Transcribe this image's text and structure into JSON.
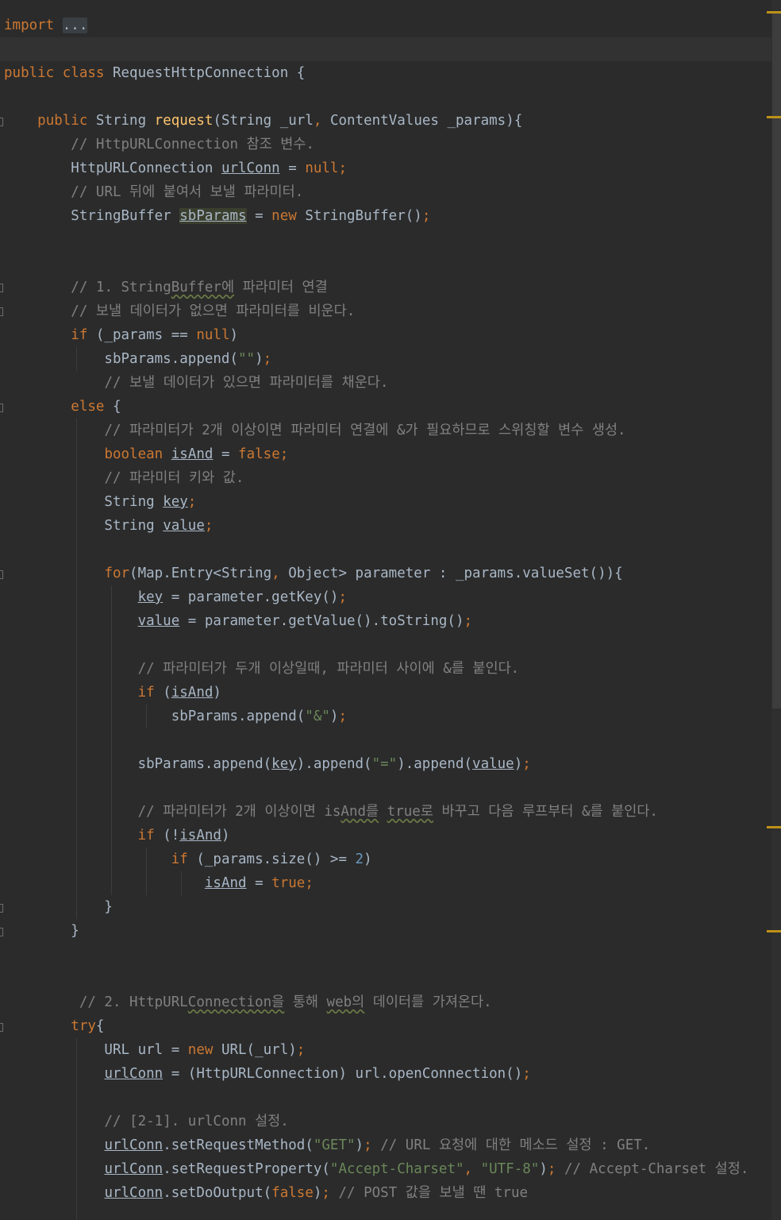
{
  "editor": {
    "language": "java",
    "theme_colors": {
      "background": "#2b2b2b",
      "keyword": "#cc7832",
      "comment": "#808080",
      "string": "#6a8759",
      "number": "#6897bb",
      "method_declaration": "#ffc66d",
      "default_text": "#a9b7c6",
      "warning_stripe": "#be9117"
    },
    "lines": [
      [
        [
          "k",
          "import"
        ],
        [
          "d",
          " "
        ],
        [
          "fold",
          "..."
        ]
      ],
      [],
      [
        [
          "k",
          "public"
        ],
        [
          "d",
          " "
        ],
        [
          "k",
          "class"
        ],
        [
          "d",
          " RequestHttpConnection {"
        ]
      ],
      [],
      [
        [
          "d",
          "    "
        ],
        [
          "k",
          "public"
        ],
        [
          "d",
          " String "
        ],
        [
          "f",
          "request"
        ],
        [
          "d",
          "(String _url"
        ],
        [
          "k",
          ","
        ],
        [
          "d",
          " ContentValues _params){"
        ]
      ],
      [
        [
          "d",
          "        "
        ],
        [
          "c",
          "// HttpURLConnection 참조 변수."
        ]
      ],
      [
        [
          "d",
          "        HttpURLConnection "
        ],
        [
          "u",
          "urlConn"
        ],
        [
          "d",
          " = "
        ],
        [
          "k",
          "null;"
        ]
      ],
      [
        [
          "d",
          "        "
        ],
        [
          "c",
          "// URL 뒤에 붙여서 보낼 파라미터."
        ]
      ],
      [
        [
          "d",
          "        StringBuffer "
        ],
        [
          "h",
          "sbParams"
        ],
        [
          "d",
          " = "
        ],
        [
          "k",
          "new"
        ],
        [
          "d",
          " StringBuffer()"
        ],
        [
          "k",
          ";"
        ]
      ],
      [],
      [],
      [
        [
          "d",
          "        "
        ],
        [
          "c",
          "// 1. String"
        ],
        [
          "cw",
          "Buffer에"
        ],
        [
          "c",
          " 파라미터 연결"
        ]
      ],
      [
        [
          "d",
          "        "
        ],
        [
          "c",
          "// 보낼 데이터가 없으면 파라미터를 비운다."
        ]
      ],
      [
        [
          "d",
          "        "
        ],
        [
          "k",
          "if"
        ],
        [
          "d",
          " (_params == "
        ],
        [
          "k",
          "null"
        ],
        [
          "d",
          ")"
        ]
      ],
      [
        [
          "d",
          "            sbParams.append("
        ],
        [
          "s",
          "\"\""
        ],
        [
          "d",
          ")"
        ],
        [
          "k",
          ";"
        ]
      ],
      [
        [
          "d",
          "            "
        ],
        [
          "c",
          "// 보낼 데이터가 있으면 파라미터를 채운다."
        ]
      ],
      [
        [
          "d",
          "        "
        ],
        [
          "k",
          "else"
        ],
        [
          "d",
          " {"
        ]
      ],
      [
        [
          "d",
          "            "
        ],
        [
          "c",
          "// 파라미터가 2개 이상이면 파라미터 연결에 &가 필요하므로 스위칭할 변수 생성."
        ]
      ],
      [
        [
          "d",
          "            "
        ],
        [
          "k",
          "boolean"
        ],
        [
          "d",
          " "
        ],
        [
          "u",
          "isAnd"
        ],
        [
          "d",
          " = "
        ],
        [
          "k",
          "false;"
        ]
      ],
      [
        [
          "d",
          "            "
        ],
        [
          "c",
          "// 파라미터 키와 값."
        ]
      ],
      [
        [
          "d",
          "            String "
        ],
        [
          "u",
          "key"
        ],
        [
          "k",
          ";"
        ]
      ],
      [
        [
          "d",
          "            String "
        ],
        [
          "u",
          "value"
        ],
        [
          "k",
          ";"
        ]
      ],
      [],
      [
        [
          "d",
          "            "
        ],
        [
          "k",
          "for"
        ],
        [
          "d",
          "(Map.Entry<String"
        ],
        [
          "k",
          ","
        ],
        [
          "d",
          " Object> parameter : _params.valueSet()){"
        ]
      ],
      [
        [
          "d",
          "                "
        ],
        [
          "u",
          "key"
        ],
        [
          "d",
          " = parameter.getKey()"
        ],
        [
          "k",
          ";"
        ]
      ],
      [
        [
          "d",
          "                "
        ],
        [
          "u",
          "value"
        ],
        [
          "d",
          " = parameter.getValue().toString()"
        ],
        [
          "k",
          ";"
        ]
      ],
      [],
      [
        [
          "d",
          "                "
        ],
        [
          "c",
          "// 파라미터가 두개 이상일때, 파라미터 사이에 &를 붙인다."
        ]
      ],
      [
        [
          "d",
          "                "
        ],
        [
          "k",
          "if"
        ],
        [
          "d",
          " ("
        ],
        [
          "u",
          "isAnd"
        ],
        [
          "d",
          ")"
        ]
      ],
      [
        [
          "d",
          "                    sbParams.append("
        ],
        [
          "s",
          "\"&\""
        ],
        [
          "d",
          ")"
        ],
        [
          "k",
          ";"
        ]
      ],
      [],
      [
        [
          "d",
          "                sbParams.append("
        ],
        [
          "u",
          "key"
        ],
        [
          "d",
          ").append("
        ],
        [
          "s",
          "\"=\""
        ],
        [
          "d",
          ").append("
        ],
        [
          "u",
          "value"
        ],
        [
          "d",
          ")"
        ],
        [
          "k",
          ";"
        ]
      ],
      [],
      [
        [
          "d",
          "                "
        ],
        [
          "c",
          "// 파라미터가 2개 이상이면 is"
        ],
        [
          "cw",
          "And를"
        ],
        [
          "c",
          " "
        ],
        [
          "cw",
          "true로"
        ],
        [
          "c",
          " 바꾸고 다음 루프부터 &를 붙인다."
        ]
      ],
      [
        [
          "d",
          "                "
        ],
        [
          "k",
          "if"
        ],
        [
          "d",
          " (!"
        ],
        [
          "u",
          "isAnd"
        ],
        [
          "d",
          ")"
        ]
      ],
      [
        [
          "d",
          "                    "
        ],
        [
          "k",
          "if"
        ],
        [
          "d",
          " (_params.size() >= "
        ],
        [
          "n",
          "2"
        ],
        [
          "d",
          ")"
        ]
      ],
      [
        [
          "d",
          "                        "
        ],
        [
          "u",
          "isAnd"
        ],
        [
          "d",
          " = "
        ],
        [
          "k",
          "true;"
        ]
      ],
      [
        [
          "d",
          "            }"
        ]
      ],
      [
        [
          "d",
          "        }"
        ]
      ],
      [],
      [],
      [
        [
          "d",
          "         "
        ],
        [
          "c",
          "// 2. HttpURL"
        ],
        [
          "cw",
          "Connection을"
        ],
        [
          "c",
          " 통해 "
        ],
        [
          "cw",
          "web의"
        ],
        [
          "c",
          " 데이터를 가져온다."
        ]
      ],
      [
        [
          "d",
          "        "
        ],
        [
          "k",
          "try"
        ],
        [
          "d",
          "{"
        ]
      ],
      [
        [
          "d",
          "            URL url = "
        ],
        [
          "k",
          "new"
        ],
        [
          "d",
          " URL(_url)"
        ],
        [
          "k",
          ";"
        ]
      ],
      [
        [
          "d",
          "            "
        ],
        [
          "u",
          "urlConn"
        ],
        [
          "d",
          " = (HttpURLConnection) url.openConnection()"
        ],
        [
          "k",
          ";"
        ]
      ],
      [],
      [
        [
          "d",
          "            "
        ],
        [
          "c",
          "// [2-1]. urlConn 설정."
        ]
      ],
      [
        [
          "d",
          "            "
        ],
        [
          "u",
          "urlConn"
        ],
        [
          "d",
          ".setRequestMethod("
        ],
        [
          "s",
          "\"GET\""
        ],
        [
          "d",
          ")"
        ],
        [
          "k",
          ";"
        ],
        [
          "d",
          " "
        ],
        [
          "c",
          "// URL 요청에 대한 메소드 설정 : GET."
        ]
      ],
      [
        [
          "d",
          "            "
        ],
        [
          "u",
          "urlConn"
        ],
        [
          "d",
          ".setRequestProperty("
        ],
        [
          "s",
          "\"Accept-Charset\""
        ],
        [
          "k",
          ","
        ],
        [
          "d",
          " "
        ],
        [
          "s",
          "\"UTF-8\""
        ],
        [
          "d",
          ")"
        ],
        [
          "k",
          ";"
        ],
        [
          "d",
          " "
        ],
        [
          "c",
          "// Accept-Charset 설정."
        ]
      ],
      [
        [
          "d",
          "            "
        ],
        [
          "u",
          "urlConn"
        ],
        [
          "d",
          ".setDoOutput("
        ],
        [
          "k",
          "false"
        ],
        [
          "d",
          ")"
        ],
        [
          "k",
          ";"
        ],
        [
          "d",
          " "
        ],
        [
          "c",
          "// POST 값을 보낼 땐 true"
        ]
      ]
    ]
  }
}
